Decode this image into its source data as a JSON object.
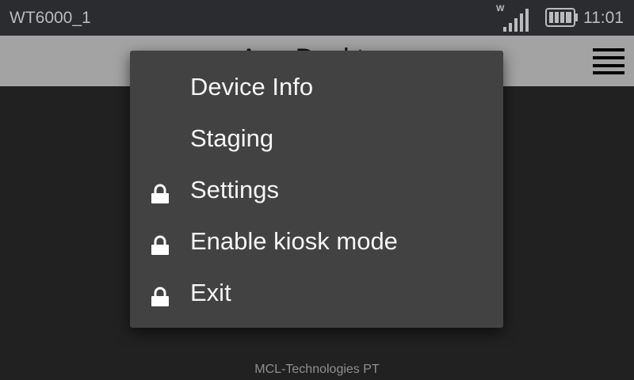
{
  "status_bar": {
    "device_name": "WT6000_1",
    "wifi_label": "W",
    "time": "11:01",
    "icons": [
      "signal-icon",
      "battery-icon"
    ]
  },
  "app_bar": {
    "title": "App Desktop",
    "menu_icon": "hamburger-menu-icon"
  },
  "menu": {
    "items": [
      {
        "label": "Device Info",
        "locked": false
      },
      {
        "label": "Staging",
        "locked": false
      },
      {
        "label": "Settings",
        "locked": true
      },
      {
        "label": "Enable kiosk mode",
        "locked": true
      },
      {
        "label": "Exit",
        "locked": true
      }
    ]
  },
  "footer": {
    "text": "MCL-Technologies PT"
  },
  "colors": {
    "status_bar_bg": "#2b2c30",
    "app_bar_bg": "#a3a3a3",
    "menu_bg": "#424242",
    "screen_bg": "#212121",
    "menu_text": "#f5f5f5"
  }
}
